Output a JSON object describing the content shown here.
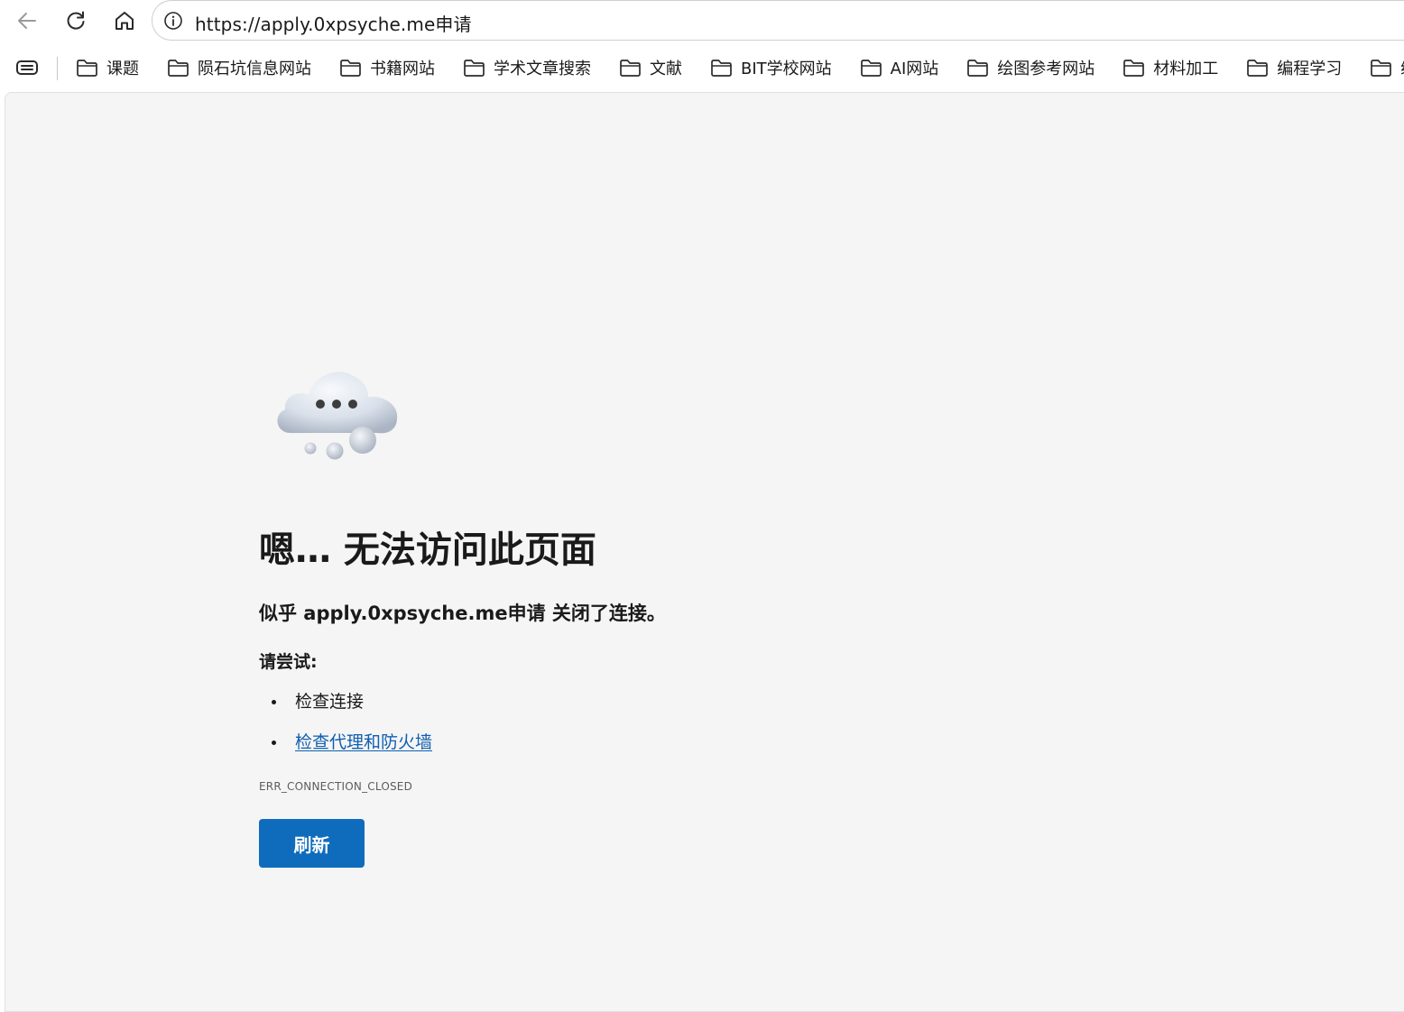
{
  "browser": {
    "address": "https://apply.0xpsyche.me申请",
    "nav_icons": [
      "back-arrow-icon",
      "reload-icon",
      "home-icon",
      "info-icon"
    ]
  },
  "bookmarks": {
    "items": [
      {
        "label": "课题"
      },
      {
        "label": "陨石坑信息网站"
      },
      {
        "label": "书籍网站"
      },
      {
        "label": "学术文章搜索"
      },
      {
        "label": "文献"
      },
      {
        "label": "BIT学校网站"
      },
      {
        "label": "AI网站"
      },
      {
        "label": "绘图参考网站"
      },
      {
        "label": "材料加工"
      },
      {
        "label": "编程学习"
      },
      {
        "label": "编程"
      }
    ],
    "icon": "folder-icon"
  },
  "error_page": {
    "title": "嗯… 无法访问此页面",
    "subtitle": "似乎 apply.0xpsyche.me申请 关闭了连接。",
    "try_heading": "请尝试:",
    "suggestions": [
      {
        "text": "检查连接",
        "is_link": false
      },
      {
        "text": "检查代理和防火墙",
        "is_link": true
      }
    ],
    "error_code": "ERR_CONNECTION_CLOSED",
    "refresh_label": "刷新",
    "illustration": "thinking-cloud-icon"
  },
  "colors": {
    "content_background": "#f5f5f5",
    "button_background": "#0f6cbd",
    "link": "#0f5fb0"
  }
}
